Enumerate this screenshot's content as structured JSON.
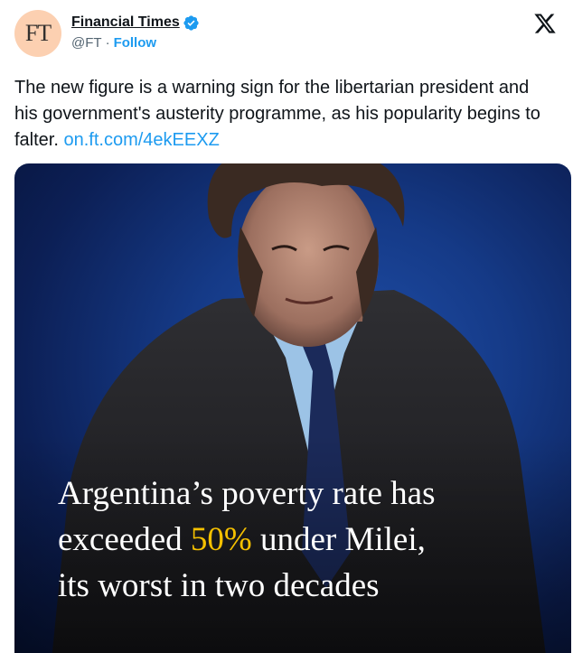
{
  "account": {
    "avatar_text": "FT",
    "display_name": "Financial Times",
    "handle": "@FT",
    "separator": "·",
    "follow_label": "Follow"
  },
  "tweet": {
    "text": "The new figure is a warning sign for the libertarian president and his government's austerity programme, as his popularity begins to falter.",
    "link": "on.ft.com/4ekEEXZ"
  },
  "media": {
    "headline_line1": "Argentina’s poverty rate has",
    "headline_line2_a": "exceeded",
    "headline_highlight": "50%",
    "headline_line2_b": "under Milei,",
    "headline_line3": "its worst in two decades"
  },
  "colors": {
    "accent": "#1d9bf0",
    "avatar_bg": "#fcd0b1",
    "highlight": "#f5c000",
    "background_blue": "#153a87"
  },
  "icons": {
    "verified": "verified-badge-icon",
    "platform": "x-logo-icon"
  }
}
